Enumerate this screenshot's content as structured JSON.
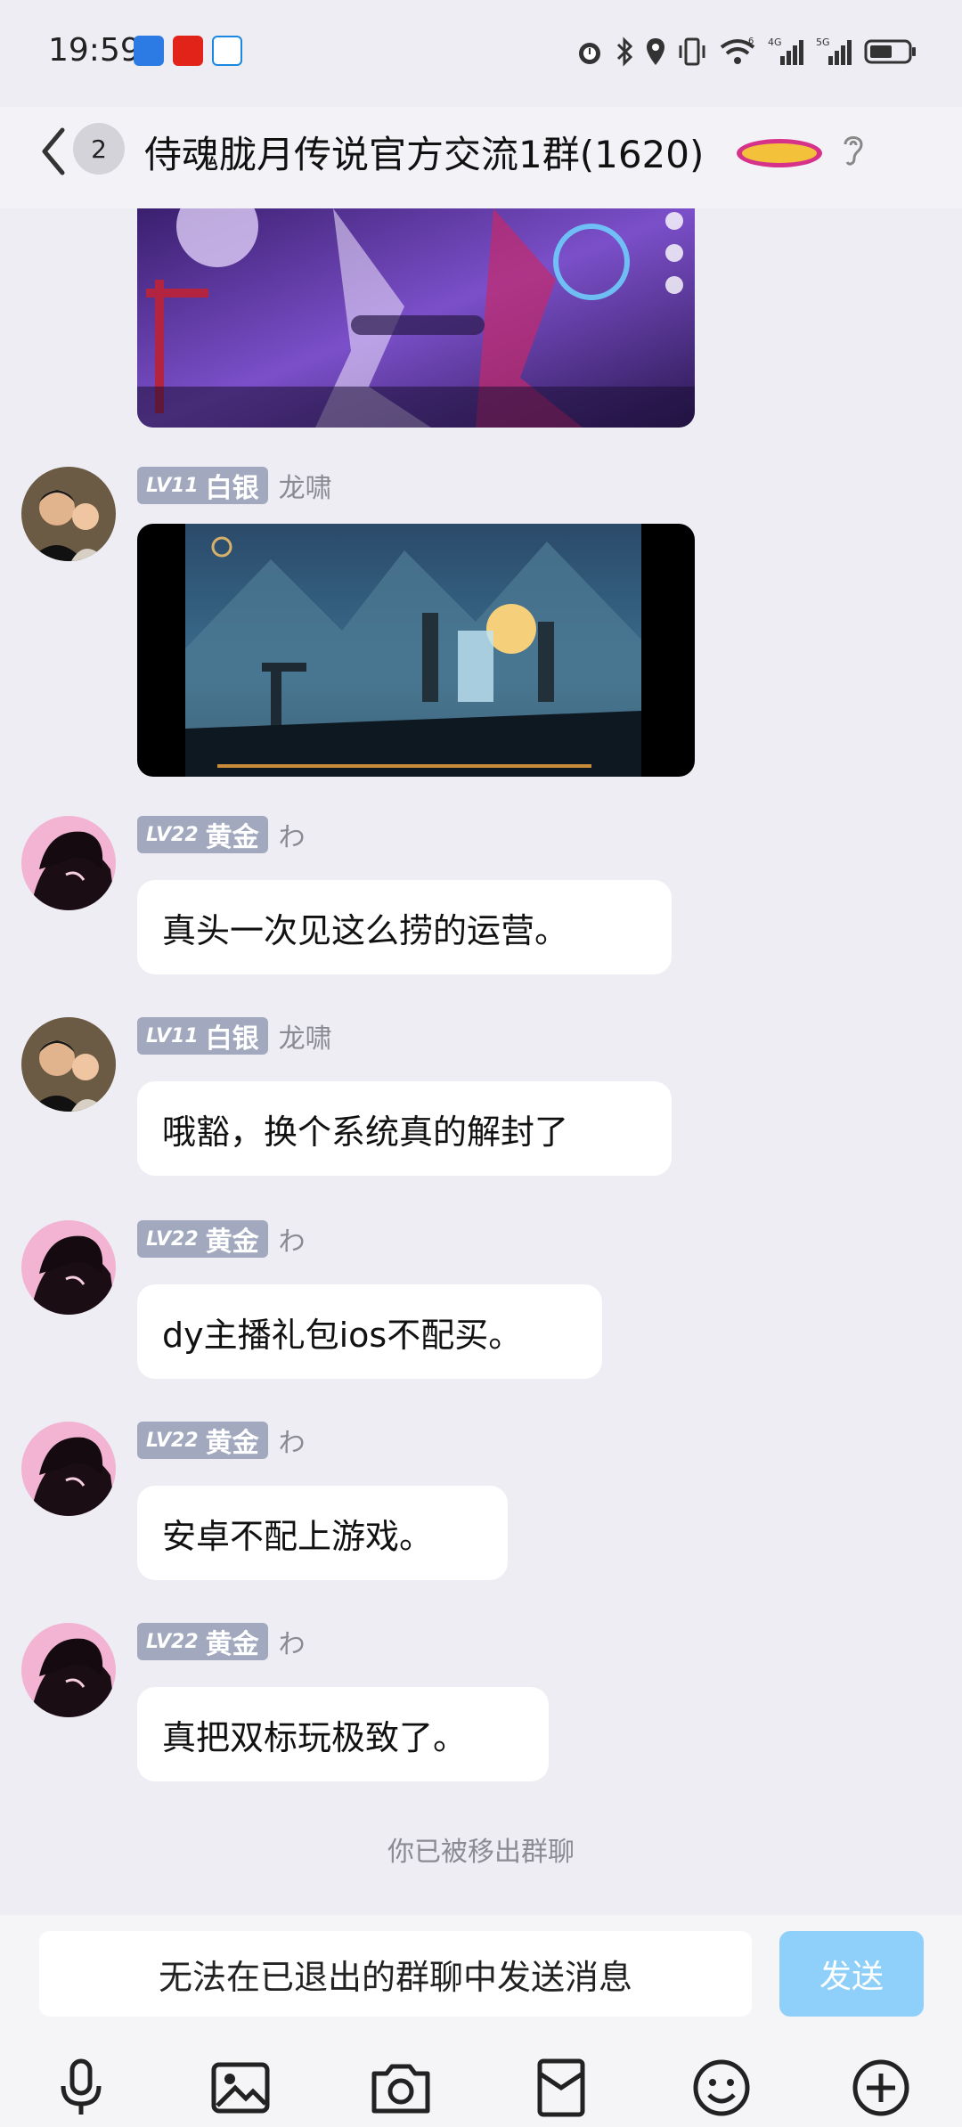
{
  "status_bar": {
    "time": "19:59",
    "icons": [
      "alarm-icon",
      "bluetooth-icon",
      "location-icon",
      "vibrate-icon",
      "wifi-icon",
      "signal-4g-icon",
      "signal-5g-icon",
      "battery-icon"
    ],
    "network_labels": [
      "6",
      "4G",
      "5G"
    ]
  },
  "header": {
    "unread_count": "2",
    "title": "侍魂胧月传说官方交流1群(1620)"
  },
  "messages": [
    {
      "type": "image",
      "alt": "game-screenshot-purple"
    },
    {
      "type": "image",
      "level": "LV11",
      "rank": "白银",
      "nick": "龙啸",
      "alt": "game-screenshot-landscape"
    },
    {
      "type": "text",
      "level": "LV22",
      "rank": "黄金",
      "nick": "わ",
      "text": "真头一次见这么捞的运营。"
    },
    {
      "type": "text",
      "level": "LV11",
      "rank": "白银",
      "nick": "龙啸",
      "text": "哦豁，换个系统真的解封了"
    },
    {
      "type": "text",
      "level": "LV22",
      "rank": "黄金",
      "nick": "わ",
      "text": "dy主播礼包ios不配买。"
    },
    {
      "type": "text",
      "level": "LV22",
      "rank": "黄金",
      "nick": "わ",
      "text": "安卓不配上游戏。"
    },
    {
      "type": "text",
      "level": "LV22",
      "rank": "黄金",
      "nick": "わ",
      "text": "真把双标玩极致了。"
    }
  ],
  "system_note": "你已被移出群聊",
  "input": {
    "placeholder": "无法在已退出的群聊中发送消息",
    "send_label": "发送"
  },
  "toolbar": [
    "microphone-icon",
    "image-icon",
    "camera-icon",
    "red-packet-icon",
    "emoji-icon",
    "plus-icon"
  ],
  "colors": {
    "background": "#ededf3",
    "level_badge": "#a2a9bf",
    "send_button": "#8fd0fa"
  }
}
